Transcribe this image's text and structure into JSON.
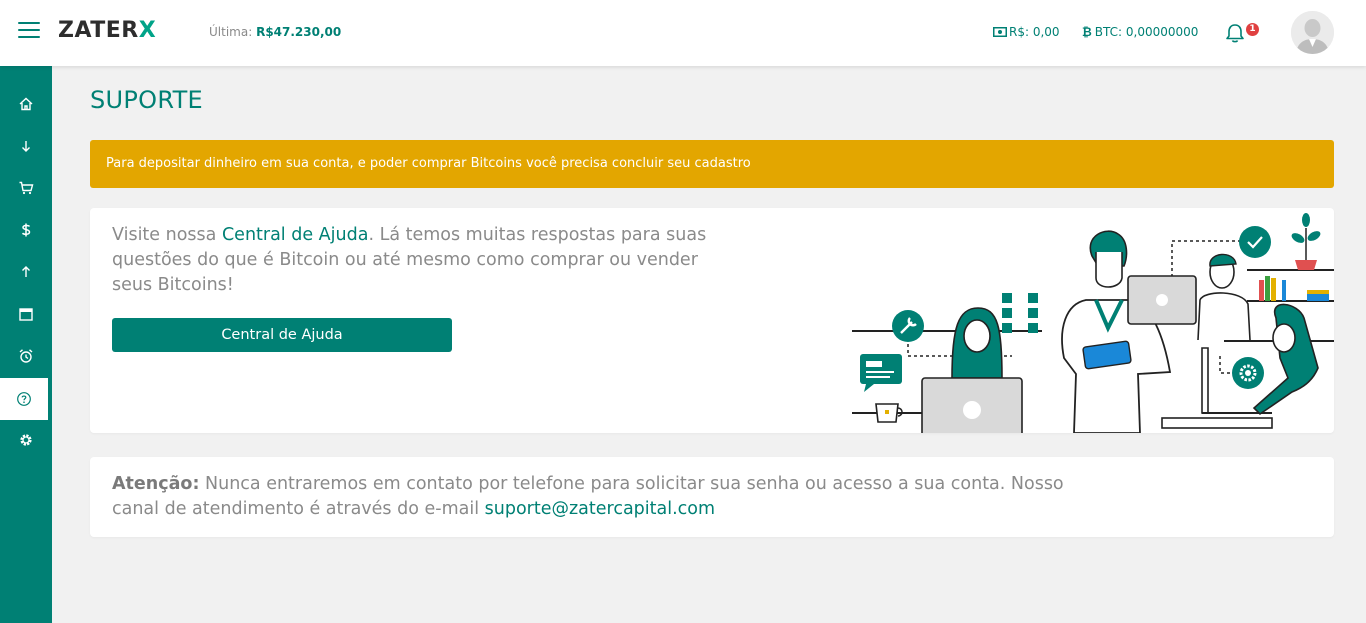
{
  "header": {
    "logo_main": "ZATER",
    "logo_accent": "X",
    "last_label": "Última:",
    "last_value": "R$47.230,00",
    "balance_brl": "R$: 0,00",
    "balance_btc": "BTC: 0,00000000",
    "btc_symbol": "₿",
    "notification_count": "1"
  },
  "sidebar": {
    "items": [
      {
        "name": "home-icon"
      },
      {
        "name": "arrow-down-icon"
      },
      {
        "name": "cart-icon"
      },
      {
        "name": "dollar-icon"
      },
      {
        "name": "arrow-up-icon"
      },
      {
        "name": "calendar-icon"
      },
      {
        "name": "alarm-clock-icon"
      },
      {
        "name": "help-icon",
        "active": true
      },
      {
        "name": "gear-icon"
      }
    ]
  },
  "page": {
    "title": "SUPORTE",
    "alert": "Para depositar dinheiro em sua conta, e poder comprar Bitcoins você precisa concluir seu cadastro"
  },
  "help_card": {
    "text_before": "Visite nossa ",
    "link": "Central de Ajuda",
    "text_after": ". Lá temos muitas respostas para suas questões do que é Bitcoin ou até mesmo como comprar ou vender seus Bitcoins!",
    "button": "Central de Ajuda"
  },
  "warning_card": {
    "label": "Atenção:",
    "text": " Nunca entraremos em contato por telefone para solicitar sua senha ou acesso a sua conta. Nosso canal de atendimento é através do e-mail ",
    "email": "suporte@zatercapital.com"
  },
  "colors": {
    "primary": "#008074",
    "accent": "#00a388",
    "alert": "#e3a600",
    "badge": "#e04040"
  }
}
